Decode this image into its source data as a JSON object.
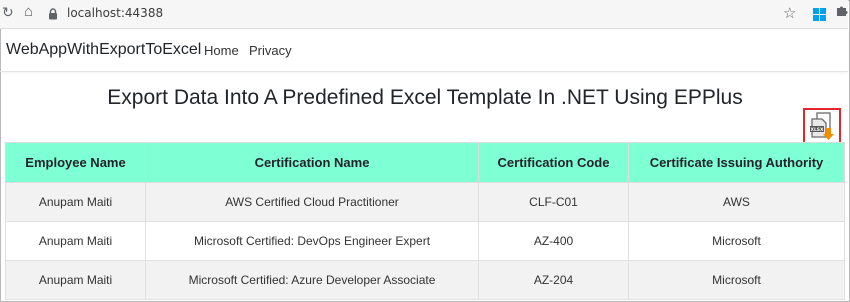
{
  "browser": {
    "url": "localhost:44388",
    "reload_icon": "reload-icon",
    "home_icon": "home-icon",
    "lock_icon": "lock-icon",
    "star_icon": "star-icon",
    "windows_icon": "windows-extension-icon",
    "puzzle_icon": "extensions-icon"
  },
  "nav": {
    "brand": "WebAppWithExportToExcel",
    "home": "Home",
    "privacy": "Privacy"
  },
  "main": {
    "title": "Export Data Into A Predefined Excel Template In .NET Using EPPlus",
    "export_icon": "xlsx-download-icon",
    "export_icon_label": "XLSX"
  },
  "table": {
    "headers": [
      "Employee Name",
      "Certification Name",
      "Certification Code",
      "Certificate Issuing Authority"
    ],
    "rows": [
      [
        "Anupam Maiti",
        "AWS Certified Cloud Practitioner",
        "CLF-C01",
        "AWS"
      ],
      [
        "Anupam Maiti",
        "Microsoft Certified: DevOps Engineer Expert",
        "AZ-400",
        "Microsoft"
      ],
      [
        "Anupam Maiti",
        "Microsoft Certified: Azure Developer Associate",
        "AZ-204",
        "Microsoft"
      ]
    ]
  },
  "colors": {
    "header_bg": "#7fffd4",
    "export_border": "#e0282e",
    "row_alt": "#f2f2f2"
  }
}
